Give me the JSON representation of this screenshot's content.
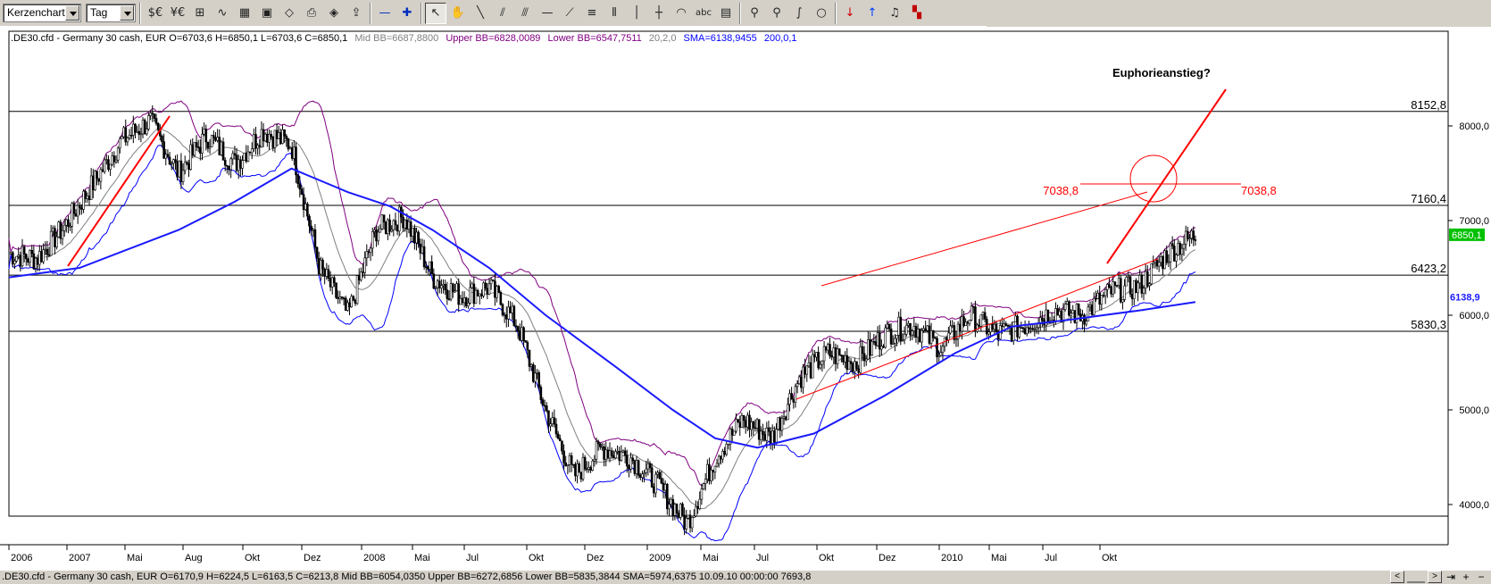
{
  "toolbar": {
    "chart_type": "Kerzenchart",
    "period": "Tag",
    "icons": [
      "currency-icon",
      "currency-swap-icon",
      "indicator-icon",
      "chart-line-icon",
      "table-icon",
      "image-icon",
      "eraser-icon",
      "print-icon",
      "gallery-icon",
      "export-icon",
      "zoom-out-icon",
      "zoom-in-icon",
      "pointer-icon",
      "hand-icon",
      "line-tool-icon",
      "channel-tool-icon",
      "parallel-lines-icon",
      "horizontal-line-icon",
      "fan-icon",
      "fibonacci-icon",
      "vertical-lines-icon",
      "vertical-line-icon",
      "crosshair-icon",
      "arc-icon",
      "text-tool-icon",
      "calculator-icon",
      "zoom-icon",
      "zoom-box-icon",
      "freehand-icon",
      "circle-tool-icon",
      "sell-arrow-icon",
      "buy-arrow-icon",
      "alarm-icon",
      "color-palette-icon"
    ],
    "text_tool": "abc"
  },
  "legend": {
    "instrument": ".DE30.cfd - Germany 30 cash, EUR O=6703,6 H=6850,1 L=6703,6 C=6850,1",
    "mid_bb": "Mid BB=6687,8800",
    "upper_bb": "Upper BB=6828,0089",
    "lower_bb": "Lower BB=6547,7511",
    "bb_params": "20,2,0",
    "sma": "SMA=6138,9455",
    "sma_params": "200,0,1"
  },
  "colors": {
    "candles": "#000000",
    "upper_bb": "#800080",
    "lower_bb": "#0000ff",
    "mid_bb": "#808080",
    "sma": "#1a1aff",
    "trend": "#ff0000",
    "last_price_bg": "#00c000"
  },
  "chart_data": {
    "type": "candlestick",
    "x_ticks": [
      "2006",
      "2007",
      "Mai",
      "Aug",
      "Okt",
      "Dez",
      "2008",
      "Mai",
      "Jul",
      "Okt",
      "Dez",
      "2009",
      "Mai",
      "Jul",
      "Okt",
      "Dez",
      "2010",
      "Mai",
      "Jul",
      "Okt"
    ],
    "y_ticks": [
      "8000,0",
      "7000,0",
      "6000,0",
      "5000,0",
      "4000,0"
    ],
    "ylim": [
      3500,
      8500
    ],
    "horizontal_levels": [
      {
        "value": 8152.8,
        "label": "8152,8"
      },
      {
        "value": 7160.4,
        "label": "7160,4"
      },
      {
        "value": 6423.2,
        "label": "6423,2"
      },
      {
        "value": 5830.3,
        "label": "5830,3"
      }
    ],
    "target_level": {
      "value": 7038.8,
      "label_left": "7038,8",
      "label_right": "7038,8"
    },
    "annotation": "Euphorieanstieg?",
    "last_price": "6850,1",
    "sma_last": "6138,9",
    "sma_series": [
      [
        0,
        6400
      ],
      [
        0.05,
        6500
      ],
      [
        0.12,
        6900
      ],
      [
        0.16,
        7200
      ],
      [
        0.2,
        7550
      ],
      [
        0.24,
        7300
      ],
      [
        0.27,
        7150
      ],
      [
        0.3,
        6900
      ],
      [
        0.34,
        6500
      ],
      [
        0.38,
        6000
      ],
      [
        0.43,
        5450
      ],
      [
        0.47,
        5000
      ],
      [
        0.5,
        4700
      ],
      [
        0.53,
        4600
      ],
      [
        0.57,
        4750
      ],
      [
        0.62,
        5150
      ],
      [
        0.67,
        5600
      ],
      [
        0.71,
        5880
      ],
      [
        0.75,
        5950
      ],
      [
        0.8,
        6050
      ],
      [
        0.84,
        6138.9
      ]
    ],
    "price_series": [
      [
        0,
        6650
      ],
      [
        0.02,
        6600
      ],
      [
        0.04,
        6950
      ],
      [
        0.06,
        7400
      ],
      [
        0.08,
        7850
      ],
      [
        0.1,
        8050
      ],
      [
        0.12,
        7500
      ],
      [
        0.14,
        7900
      ],
      [
        0.16,
        7600
      ],
      [
        0.18,
        7950
      ],
      [
        0.2,
        7800
      ],
      [
        0.22,
        6500
      ],
      [
        0.24,
        6000
      ],
      [
        0.26,
        6900
      ],
      [
        0.28,
        7050
      ],
      [
        0.3,
        6400
      ],
      [
        0.32,
        6200
      ],
      [
        0.34,
        6300
      ],
      [
        0.36,
        5900
      ],
      [
        0.38,
        5000
      ],
      [
        0.4,
        4300
      ],
      [
        0.42,
        4600
      ],
      [
        0.44,
        4500
      ],
      [
        0.46,
        4200
      ],
      [
        0.48,
        3800
      ],
      [
        0.5,
        4500
      ],
      [
        0.52,
        4900
      ],
      [
        0.54,
        4700
      ],
      [
        0.56,
        5350
      ],
      [
        0.58,
        5600
      ],
      [
        0.6,
        5500
      ],
      [
        0.62,
        5800
      ],
      [
        0.64,
        5900
      ],
      [
        0.66,
        5650
      ],
      [
        0.68,
        6000
      ],
      [
        0.7,
        5800
      ],
      [
        0.72,
        5900
      ],
      [
        0.74,
        6050
      ],
      [
        0.76,
        6000
      ],
      [
        0.78,
        6250
      ],
      [
        0.8,
        6300
      ],
      [
        0.82,
        6650
      ],
      [
        0.84,
        6850.1
      ]
    ]
  },
  "statusbar": {
    "text": ".DE30.cfd - Germany 30 cash, EUR O=6170,9 H=6224,5 L=6163,5 C=6213,8  Mid BB=6054,0350 Upper BB=6272,6856 Lower BB=5835,3844 SMA=5974,6375  10.09.10 00:00:00 7693,8",
    "controls": [
      "<",
      ">",
      "+",
      "−"
    ]
  }
}
